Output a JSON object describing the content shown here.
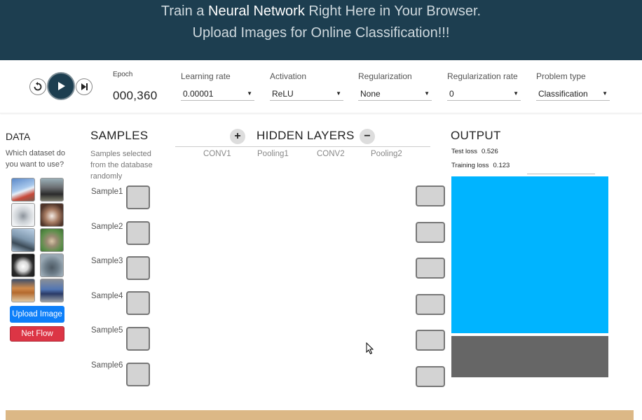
{
  "header": {
    "line1_pre": "Train a",
    "line1_bold": "Neural Network",
    "line1_post": "Right Here in Your Browser.",
    "line2": "Upload Images for Online Classification!!!"
  },
  "controls": {
    "epoch_label": "Epoch",
    "epoch_value": "000,360",
    "learning_rate": {
      "label": "Learning rate",
      "value": "0.00001"
    },
    "activation": {
      "label": "Activation",
      "value": "ReLU"
    },
    "regularization": {
      "label": "Regularization",
      "value": "None"
    },
    "regularization_rate": {
      "label": "Regularization rate",
      "value": "0"
    },
    "problem_type": {
      "label": "Problem type",
      "value": "Classification"
    },
    "icons": [
      "reset-icon",
      "play-icon",
      "step-forward-icon"
    ]
  },
  "data_panel": {
    "title": "DATA",
    "subtitle": "Which dataset do you want to use?",
    "datasets": [
      "truck",
      "horse",
      "airplane",
      "cat",
      "bird",
      "deer",
      "dog",
      "frog",
      "car",
      "automobile"
    ],
    "upload_label": "Upload Image",
    "netflow_label": "Net Flow"
  },
  "samples": {
    "title": "SAMPLES",
    "subtitle": "Samples selected from the database randomly",
    "items": [
      "Sample1",
      "Sample2",
      "Sample3",
      "Sample4",
      "Sample5",
      "Sample6"
    ]
  },
  "hidden_layers": {
    "title": "HIDDEN LAYERS",
    "plus": "+",
    "minus": "−",
    "layers": [
      "CONV1",
      "Pooling1",
      "CONV2",
      "Pooling2"
    ]
  },
  "output": {
    "title": "OUTPUT",
    "test_loss_label": "Test loss",
    "test_loss_value": "0.526",
    "training_loss_label": "Training loss",
    "training_loss_value": "0.123"
  },
  "colors": {
    "header_bg": "#1d3e50",
    "output_blue": "#00b4ff",
    "output_gray": "#666666",
    "upload_button": "#0d7ff9",
    "netflow_button": "#dc3545",
    "footer_bar": "#dcb886"
  }
}
